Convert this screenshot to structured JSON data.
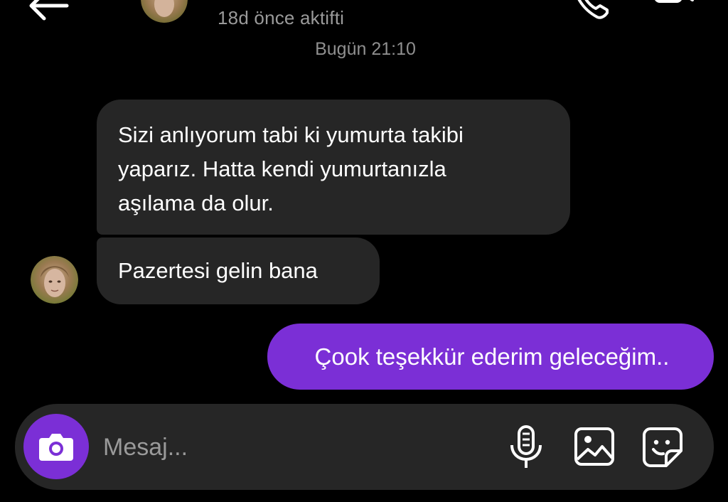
{
  "header": {
    "status": "18d önce aktifti"
  },
  "timestamp": "Bugün 21:10",
  "messages": {
    "incoming_1": "Sizi anlıyorum tabi ki yumurta takibi\nyaparız. Hatta kendi yumurtanızla\naşılama da olur.",
    "incoming_2": "Pazertesi gelin bana",
    "outgoing_1": "Çook teşekkür ederim geleceğim.."
  },
  "composer": {
    "placeholder": "Mesaj..."
  },
  "icons": {
    "back": "arrow-left-icon",
    "call": "phone-icon",
    "video": "video-camera-icon",
    "camera": "camera-icon",
    "mic": "microphone-icon",
    "gallery": "image-icon",
    "sticker": "sticker-icon"
  },
  "colors": {
    "background": "#000000",
    "incoming_bubble": "#262626",
    "outgoing_bubble": "#7b2fd6",
    "accent": "#7b2fd6",
    "muted_text": "#9a9a9a"
  }
}
